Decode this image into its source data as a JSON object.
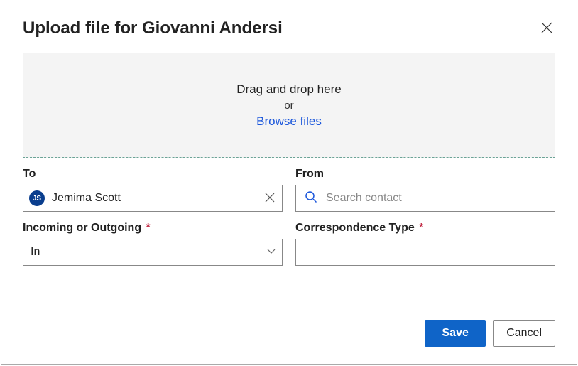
{
  "dialog": {
    "title": "Upload file for Giovanni Andersi"
  },
  "dropzone": {
    "line1": "Drag and drop here",
    "line2": "or",
    "browse": "Browse files"
  },
  "fields": {
    "to": {
      "label": "To",
      "value": "Jemima Scott",
      "initials": "JS"
    },
    "from": {
      "label": "From",
      "placeholder": "Search contact"
    },
    "direction": {
      "label": "Incoming or Outgoing",
      "value": "In"
    },
    "corrType": {
      "label": "Correspondence Type"
    }
  },
  "buttons": {
    "save": "Save",
    "cancel": "Cancel"
  },
  "required_marker": "*"
}
